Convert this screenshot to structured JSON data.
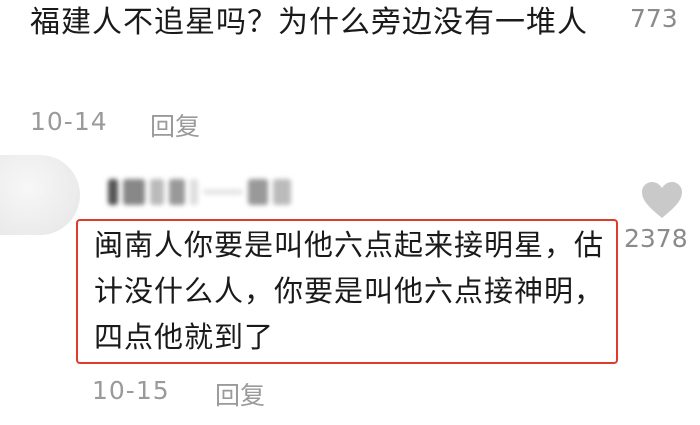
{
  "comment1": {
    "text": "福建人不追星吗？为什么旁边没有一堆人",
    "likes": "773",
    "date": "10-14",
    "reply_label": "回复"
  },
  "comment2": {
    "text": "闽南人你要是叫他六点起来接明星，估计没什么人，你要是叫他六点接神明，四点他就到了",
    "likes": "2378",
    "date": "10-15",
    "reply_label": "回复",
    "like_icon": "heart-icon",
    "username_state": "blurred"
  },
  "colors": {
    "highlight_border": "#e23a2a",
    "meta_text": "#9a9a9a",
    "heart": "#c9c9c9"
  }
}
